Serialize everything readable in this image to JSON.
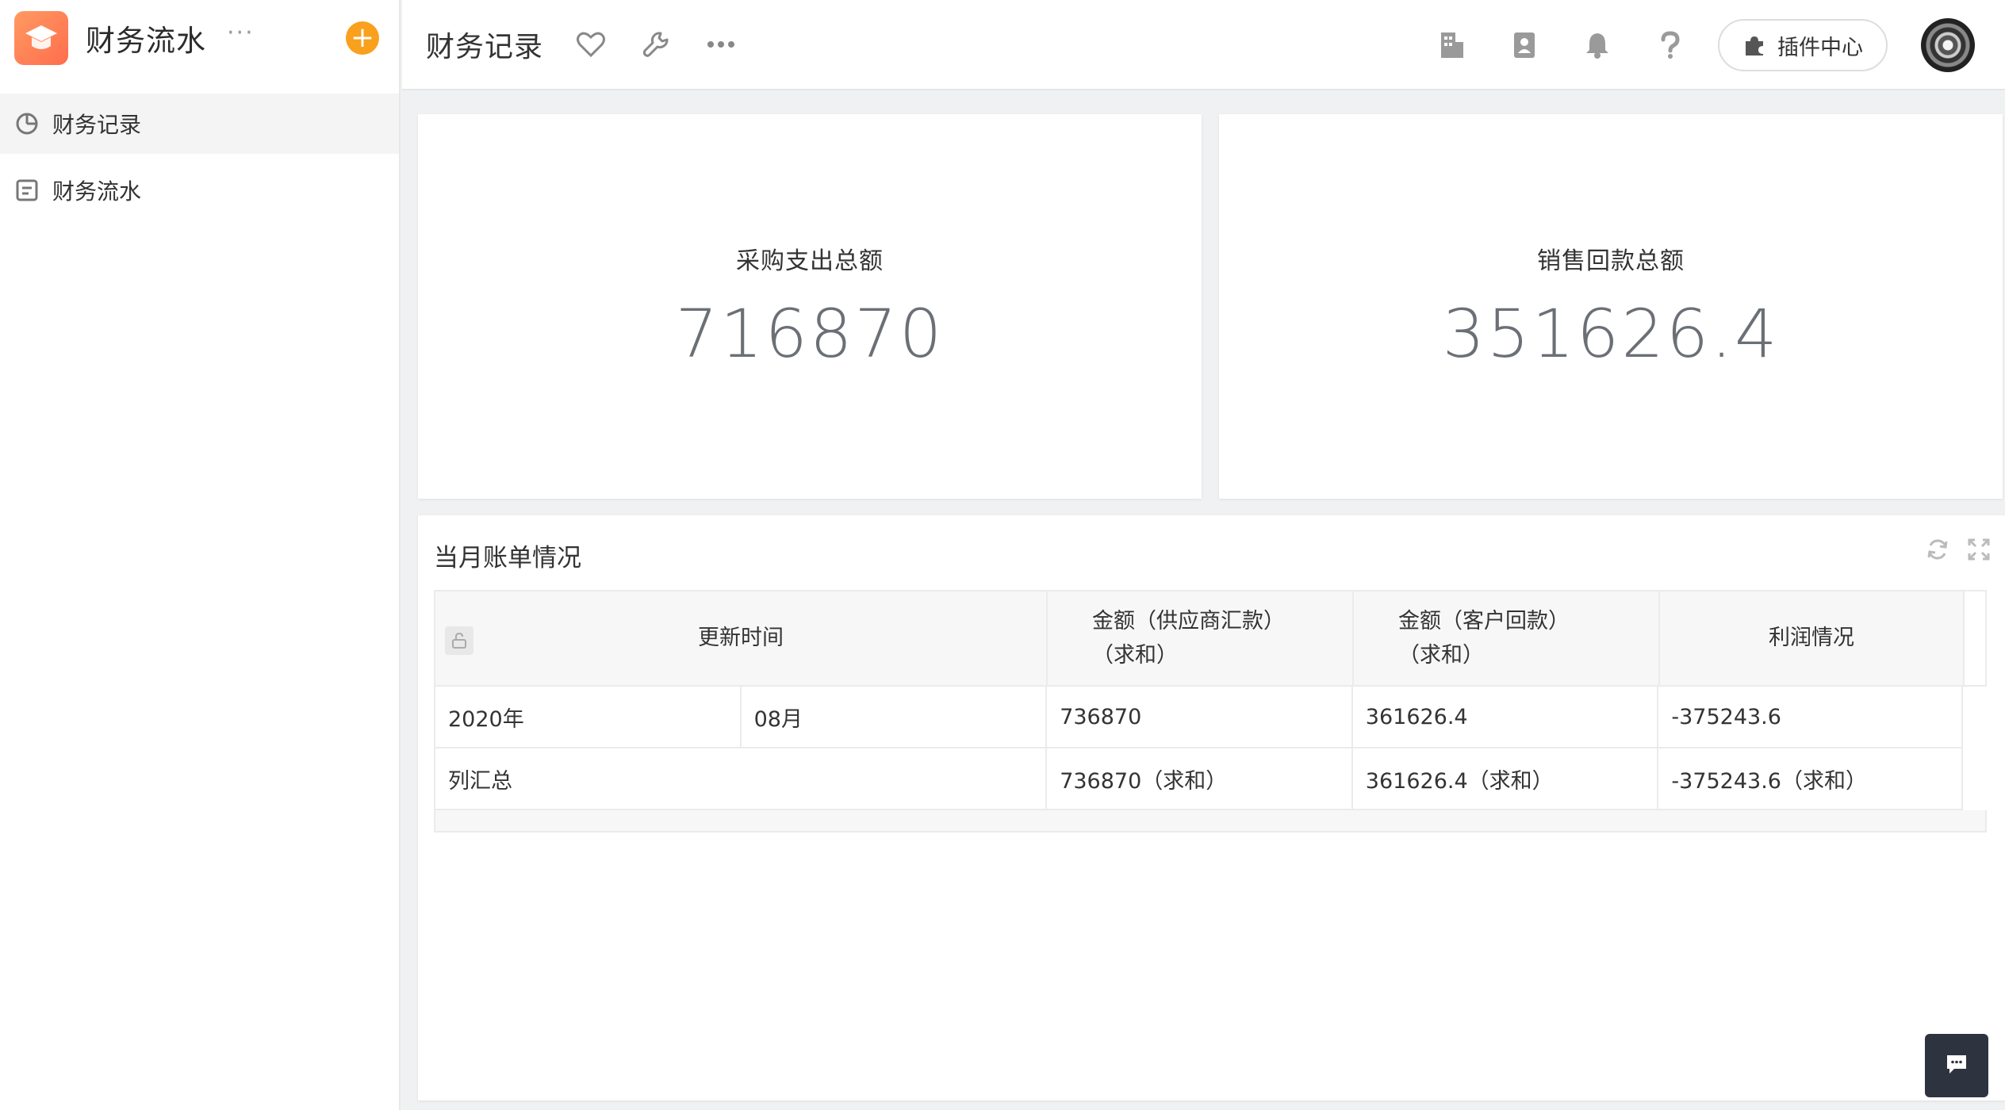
{
  "sidebar": {
    "app_title": "财务流水",
    "more_label": "···",
    "add_label": "+",
    "items": [
      {
        "label": "财务记录",
        "icon": "pie-chart-icon",
        "active": true
      },
      {
        "label": "财务流水",
        "icon": "form-icon",
        "active": false
      }
    ]
  },
  "topbar": {
    "page_title": "财务记录",
    "plugin_label": "插件中心"
  },
  "stats": [
    {
      "label": "采购支出总额",
      "value": "716870"
    },
    {
      "label": "销售回款总额",
      "value": "351626.4"
    }
  ],
  "table_card": {
    "title": "当月账单情况",
    "headers": {
      "time": "更新时间",
      "supplier_line1": "金额（供应商汇款）",
      "supplier_line2": "（求和）",
      "customer_line1": "金额（客户回款）",
      "customer_line2": "（求和）",
      "profit": "利润情况"
    },
    "rows": [
      {
        "year": "2020年",
        "month": "08月",
        "supplier": "736870",
        "customer": "361626.4",
        "profit": "-375243.6"
      }
    ],
    "summary": {
      "label": "列汇总",
      "supplier": "736870（求和）",
      "customer": "361626.4（求和）",
      "profit": "-375243.6（求和）"
    }
  },
  "colors": {
    "logo": "#ff7a52",
    "add_button": "#f9a01d",
    "stat_value": "#6b6f76",
    "chat_button": "#2d3440"
  }
}
